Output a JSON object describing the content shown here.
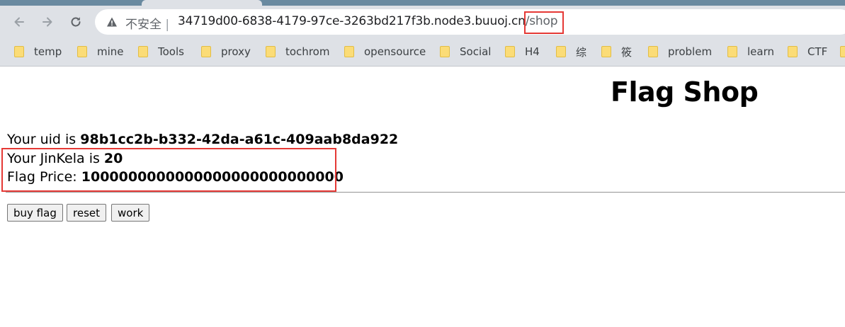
{
  "browser": {
    "security_label": "不安全",
    "url_host": "34719d00-6838-4179-97ce-3263bd217f3b.node3.buuoj.cn",
    "url_path": "/shop",
    "bookmarks": [
      {
        "label": "temp"
      },
      {
        "label": "mine"
      },
      {
        "label": "Tools"
      },
      {
        "label": "proxy"
      },
      {
        "label": "tochrom"
      },
      {
        "label": "opensource"
      },
      {
        "label": "Social"
      },
      {
        "label": "H4"
      },
      {
        "label": "综"
      },
      {
        "label": "筱"
      },
      {
        "label": "problem"
      },
      {
        "label": "learn"
      },
      {
        "label": "CTF"
      }
    ],
    "icons": {
      "back": "back-arrow-icon",
      "forward": "forward-arrow-icon",
      "reload": "reload-icon",
      "warning": "warning-icon",
      "folder": "folder-icon"
    }
  },
  "page": {
    "title": "Flag Shop",
    "uid_label": "Your uid is ",
    "uid_value": "98b1cc2b-b332-42da-a61c-409aab8da922",
    "jinkela_label": "Your JinKela is ",
    "jinkela_value": "20",
    "price_label": "Flag Price: ",
    "price_value": "1000000000000000000000000000",
    "buttons": {
      "buy": "buy flag",
      "reset": "reset",
      "work": "work"
    }
  },
  "colors": {
    "highlight": "#e53935",
    "chrome": "#dee1e6",
    "tabstrip": "#6a8aa0"
  }
}
